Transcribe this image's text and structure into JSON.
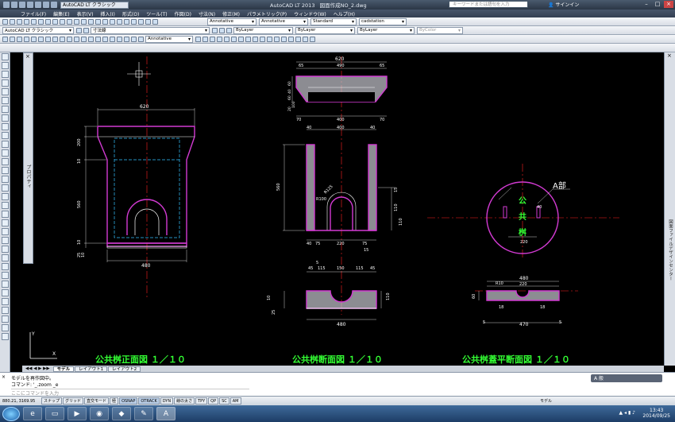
{
  "window": {
    "app_title": "AutoCAD LT 2013",
    "document": "図面作成NO_2.dwg",
    "workspace": "AutoCAD LT クラシック",
    "search_placeholder": "キーワードまたは語句を入力",
    "signin": "サインイン"
  },
  "menu": [
    "ファイル(F)",
    "編集(E)",
    "表示(V)",
    "挿入(I)",
    "形式(O)",
    "ツール(T)",
    "作図(D)",
    "寸法(N)",
    "修正(M)",
    "パラメトリック(P)",
    "ウィンドウ(W)",
    "ヘルプ(H)"
  ],
  "toolbar": {
    "text_style": "Annotative",
    "dim_style": "Annotative",
    "table_style": "Standard",
    "mleader_style": "cadstation",
    "workspace_dd": "AutoCAD LT クラシック",
    "layer": "寸法線",
    "color": "ByLayer",
    "linetype": "ByLayer",
    "lineweight": "ByLayer",
    "plotstyle": "ByColor",
    "annot_scale": "Annotative"
  },
  "drawing": {
    "front_title": "公共桝正面図 １／１０",
    "section_title": "公共桝断面図 １／１０",
    "plan_title": "公共桝蓋平断面図 １／１０",
    "callout": "A部",
    "lid_chars": [
      "公",
      "共",
      "桝"
    ],
    "dims": {
      "front_top": "620",
      "front_bottom": "480",
      "front_h1": "200",
      "front_h2": "10",
      "front_h3": "560",
      "front_h4": "10",
      "front_h5": "25",
      "front_h6": "10",
      "sec_top": "620",
      "sec_a": "65",
      "sec_b": "490",
      "sec_c": "65",
      "sec_d": "70",
      "sec_e": "400",
      "sec_f": "70",
      "sec_g": "40",
      "sec_h": "400",
      "sec_i": "40",
      "sec_j": "560",
      "sec_k": "110",
      "sec_l": "15",
      "sec_m": "40",
      "sec_n": "75",
      "sec_o": "220",
      "sec_p": "75",
      "sec_q": "15",
      "sec_r": "R100",
      "sec_s": "R125",
      "sec_v1": "60",
      "sec_v2": "40",
      "sec_v3": "60",
      "sec_v4": "100",
      "sec_v5": "20",
      "sec_v6": "110",
      "bot_a": "45",
      "bot_b": "115",
      "bot_c": "150",
      "bot_d": "115",
      "bot_e": "45",
      "bot_w": "480",
      "bot_h1": "110",
      "bot_h2": "10",
      "bot_h3": "25",
      "bot_r": "5",
      "plan_a": "480",
      "plan_b": "220",
      "plan_c": "18",
      "plan_d": "18",
      "plan_e": "470",
      "plan_f": "5",
      "plan_g": "5",
      "plan_r": "R10",
      "plan_h": "60",
      "circ_a": "220",
      "circ_b": "40"
    }
  },
  "tabs": [
    "モデル",
    "レイアウト1",
    "レイアウト2"
  ],
  "command": {
    "line1": "モデルを再作図中。",
    "line2": "コマンド:  '_.zoom  _e",
    "prompt": "ここにコマンドを入力"
  },
  "status": {
    "coords": "880.21, 3169.95",
    "toggles": [
      "スナップ",
      "グリッド",
      "直交モード",
      "極",
      "OSNAP",
      "OTRACK",
      "DYN",
      "線の太さ",
      "TPY",
      "QP",
      "SC",
      "AM"
    ],
    "on": [
      4,
      5
    ],
    "model": "モデル"
  },
  "props_label": "プロパティ",
  "right_label": "図面ファイルデザインセンター",
  "clock": {
    "time": "13:43",
    "date": "2014/09/25"
  },
  "tray": "A 般"
}
